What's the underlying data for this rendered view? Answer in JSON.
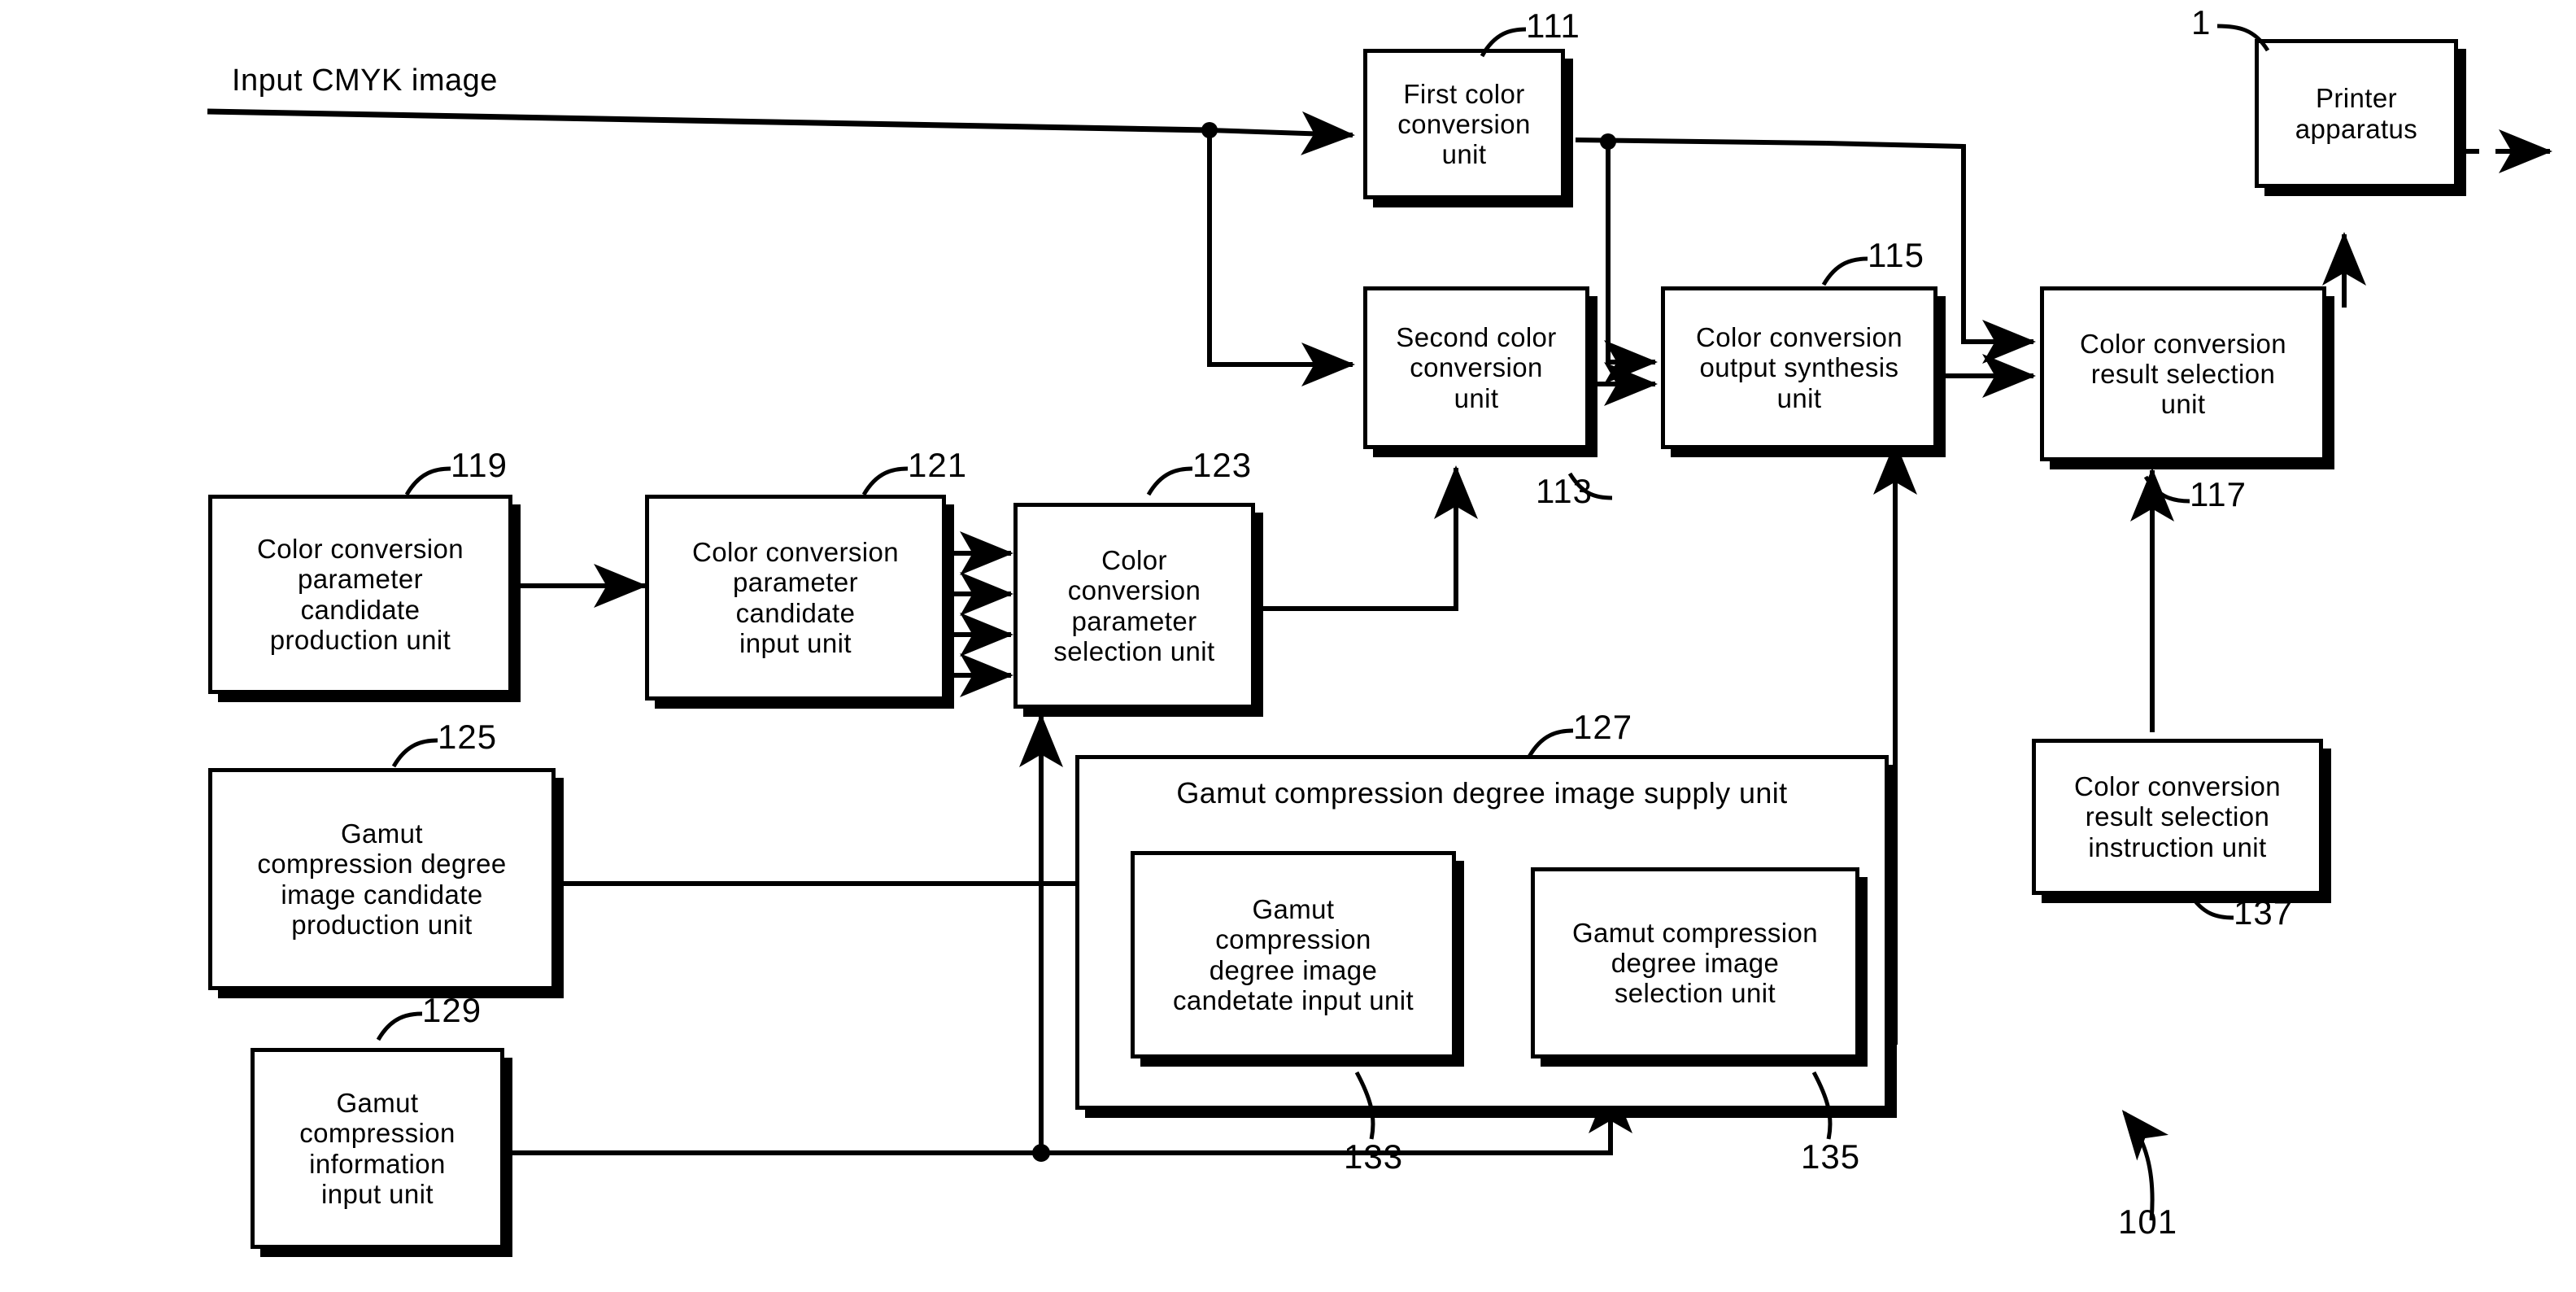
{
  "figure": {
    "label_input": "Input CMYK image",
    "system_ref": "101",
    "printer_ref": "1"
  },
  "blocks": [
    {
      "id": "first_color_conversion",
      "ref": "111",
      "text": "First color\nconversion\nunit"
    },
    {
      "id": "second_color_conversion",
      "ref": "113",
      "text": "Second color\nconversion\nunit"
    },
    {
      "id": "color_conversion_output_synthesis",
      "ref": "115",
      "text": "Color conversion\noutput synthesis\nunit"
    },
    {
      "id": "color_conversion_result_selection",
      "ref": "117",
      "text": "Color conversion\nresult selection\nunit"
    },
    {
      "id": "printer_apparatus",
      "ref": "1",
      "text": "Printer\napparatus"
    },
    {
      "id": "cc_param_candidate_production",
      "ref": "119",
      "text": "Color conversion\nparameter\ncandidate\nproduction unit"
    },
    {
      "id": "cc_param_candidate_input",
      "ref": "121",
      "text": "Color conversion\nparameter\ncandidate\ninput unit"
    },
    {
      "id": "cc_param_selection",
      "ref": "123",
      "text": "Color\nconversion\nparameter\nselection unit"
    },
    {
      "id": "gamut_degree_image_candidate_production",
      "ref": "125",
      "text": "Gamut\ncompression degree\nimage candidate\nproduction unit"
    },
    {
      "id": "gamut_degree_image_supply",
      "ref": "127",
      "text": "Gamut compression degree image supply unit"
    },
    {
      "id": "gamut_compression_information_input",
      "ref": "129",
      "text": "Gamut\ncompression\ninformation\ninput unit"
    },
    {
      "id": "gamut_degree_image_candidate_input",
      "ref": "133",
      "text": "Gamut\ncompression\ndegree image\ncandetate input unit"
    },
    {
      "id": "gamut_degree_image_selection",
      "ref": "135",
      "text": "Gamut compression\ndegree image\nselection unit"
    },
    {
      "id": "cc_result_selection_instruction",
      "ref": "137",
      "text": "Color conversion\nresult selection\ninstruction unit"
    }
  ],
  "refs": {
    "r1": "1",
    "r101": "101",
    "r111": "111",
    "r113": "113",
    "r115": "115",
    "r117": "117",
    "r119": "119",
    "r121": "121",
    "r123": "123",
    "r125": "125",
    "r127": "127",
    "r129": "129",
    "r133": "133",
    "r135": "135",
    "r137": "137"
  },
  "colors": {
    "ink": "#000000",
    "paper": "#ffffff"
  }
}
